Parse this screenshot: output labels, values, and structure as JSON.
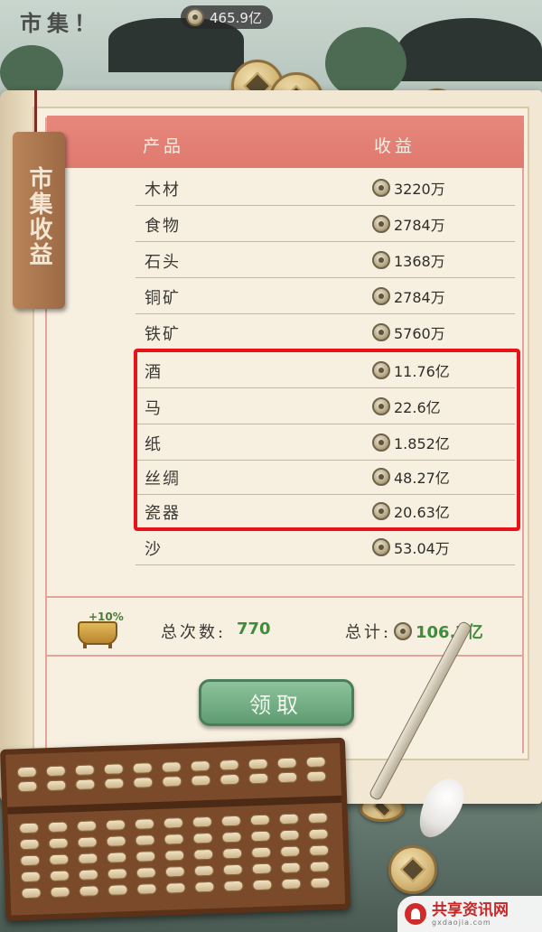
{
  "topbar": {
    "title": "市集！",
    "money": "465.9亿"
  },
  "panel": {
    "tag_title": "市集收益",
    "header": {
      "product": "产品",
      "income": "收益"
    },
    "rows": [
      {
        "name": "木材",
        "value": "3220万"
      },
      {
        "name": "食物",
        "value": "2784万"
      },
      {
        "name": "石头",
        "value": "1368万"
      },
      {
        "name": "铜矿",
        "value": "2784万"
      },
      {
        "name": "铁矿",
        "value": "5760万"
      },
      {
        "name": "酒",
        "value": "11.76亿"
      },
      {
        "name": "马",
        "value": "22.6亿"
      },
      {
        "name": "纸",
        "value": "1.852亿"
      },
      {
        "name": "丝绸",
        "value": "48.27亿"
      },
      {
        "name": "瓷器",
        "value": "20.63亿"
      },
      {
        "name": "沙",
        "value": "53.04万"
      }
    ],
    "bonus": "+10%",
    "total_count_label": "总次数:",
    "total_count": "770",
    "total_label": "总计:",
    "total_value": "106.7亿",
    "claim_button": "领取"
  },
  "watermark": {
    "title": "共享资讯网",
    "subtitle": "gxdaojia.com"
  },
  "colors": {
    "header_band": "#df7a6f",
    "highlight_box": "#e8131a",
    "claim_button": "#6fa97f",
    "total_green": "#3f8c3a"
  }
}
